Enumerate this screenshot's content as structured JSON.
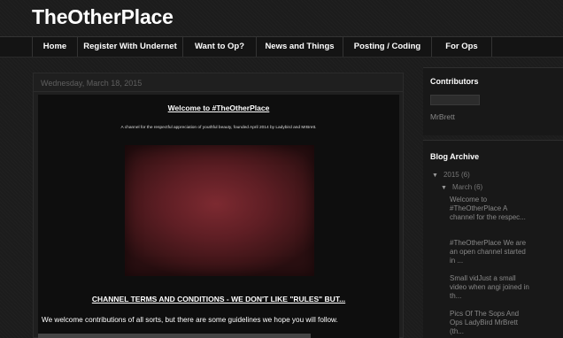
{
  "site": {
    "title": "TheOtherPlace"
  },
  "nav": {
    "tabs": [
      {
        "label": "Home"
      },
      {
        "label": "Register With Undernet"
      },
      {
        "label": "Want to Op?"
      },
      {
        "label": "News and Things"
      },
      {
        "label": "Posting / Coding"
      },
      {
        "label": "For Ops"
      }
    ]
  },
  "post": {
    "date": "Wednesday, March 18, 2015",
    "title": "Welcome to #TheOtherPlace",
    "description": "A channel for the respectful appreciation of youthful beauty, founded April 2014 by Ladybird and MrBrett.",
    "section_heading": "CHANNEL TERMS AND CONDITIONS - WE DON'T LIKE \"RULES\" BUT...",
    "body": "We welcome contributions of all sorts, but there are some guidelines we hope you will follow."
  },
  "sidebar": {
    "contributors": {
      "title": "Contributors",
      "names": [
        "MrBrett"
      ]
    },
    "archive": {
      "title": "Blog Archive",
      "year": {
        "label": "2015",
        "count": "(6)"
      },
      "month": {
        "label": "March",
        "count": "(6)"
      },
      "posts": [
        "Welcome to #TheOtherPlace A channel for the respec...",
        "#TheOtherPlace We are an open channel started in ...",
        "Small vidJust a small video when angi joined in th...",
        "Pics Of The Sops And Ops LadyBird MrBrett (th..."
      ]
    }
  }
}
